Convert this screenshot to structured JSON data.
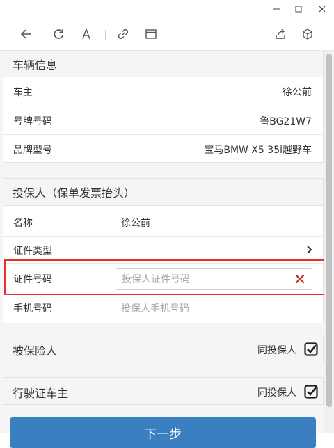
{
  "window": {
    "minimize": "—",
    "maximize": "☐",
    "close": "✕"
  },
  "vehicle": {
    "title": "车辆信息",
    "rows": [
      {
        "label": "车主",
        "value": "徐公前"
      },
      {
        "label": "号牌号码",
        "value": "鲁BG21W7"
      },
      {
        "label": "品牌型号",
        "value": "宝马BMW X5 35i越野车"
      }
    ]
  },
  "insured_applicant": {
    "title": "投保人（保单发票抬头）",
    "name_label": "名称",
    "name_value": "徐公前",
    "id_type_label": "证件类型",
    "id_no_label": "证件号码",
    "id_no_placeholder": "投保人证件号码",
    "id_no_value": "",
    "phone_label": "手机号码",
    "phone_placeholder": "投保人手机号码"
  },
  "insured": {
    "label": "被保险人",
    "same_label": "同投保人",
    "checked": true
  },
  "license_owner": {
    "label": "行驶证车主",
    "same_label": "同投保人",
    "checked": true
  },
  "next_button": "下一步",
  "colors": {
    "primary": "#3a7fc0",
    "highlight": "#e8302a",
    "clear": "#c0392b"
  }
}
